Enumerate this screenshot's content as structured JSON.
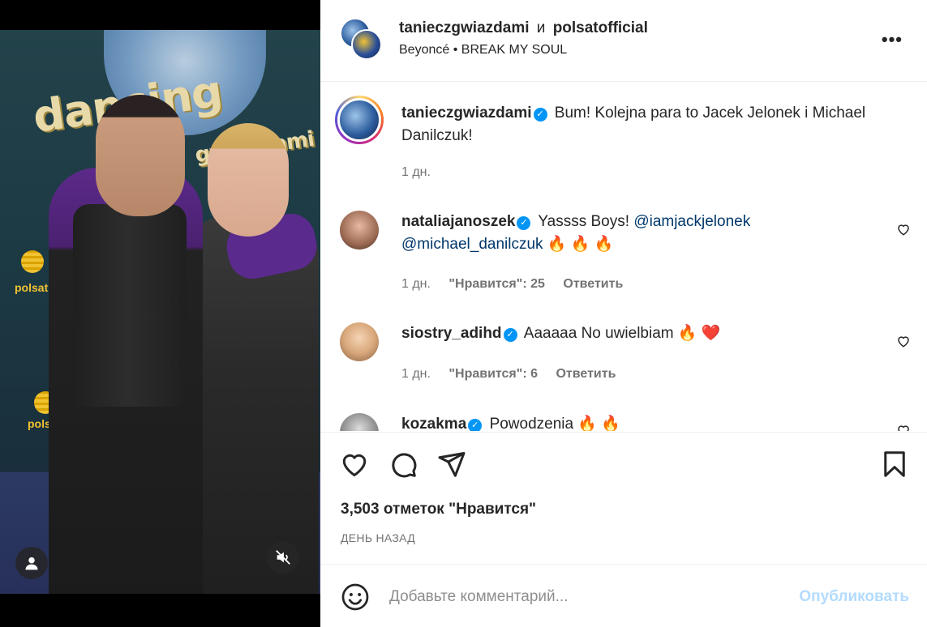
{
  "header": {
    "account_1": "tanieczgwiazdami",
    "and_label": "и",
    "account_2": "polsatofficial",
    "audio_artist": "Beyoncé",
    "audio_separator": "•",
    "audio_track": "BREAK MY SOUL",
    "more_label": "•••"
  },
  "media": {
    "logo_word_1": "dancing",
    "logo_word_2": "gwiazdami",
    "brand": "polsat"
  },
  "caption": {
    "username": "tanieczgwiazdami",
    "text": "Bum! Kolejna para to Jacek Jelonek i Michael Danilczuk!",
    "time": "1 дн."
  },
  "comments": [
    {
      "username": "nataliajanoszek",
      "text": "Yassss Boys!",
      "mention_1": "@iamjackjelonek",
      "mention_2": "@michael_danilczuk",
      "emojis": "🔥 🔥 🔥",
      "time": "1 дн.",
      "likes": "\"Нравится\": 25",
      "reply": "Ответить"
    },
    {
      "username": "siostry_adihd",
      "text": "Aaaaaa No uwielbiam",
      "emoji_fire": "🔥",
      "emoji_heart": "❤️",
      "time": "1 дн.",
      "likes": "\"Нравится\": 6",
      "reply": "Ответить"
    },
    {
      "username": "kozakma",
      "text": "Powodzenia",
      "emojis": "🔥 🔥"
    }
  ],
  "likes_text": "3,503 отметок \"Нравится\"",
  "date_text": "ДЕНЬ НАЗАД",
  "comment_box": {
    "placeholder": "Добавьте комментарий...",
    "publish": "Опубликовать"
  },
  "colors": {
    "verified": "#0095f6",
    "publish_disabled": "#b3dbff",
    "mention": "#00376b"
  }
}
